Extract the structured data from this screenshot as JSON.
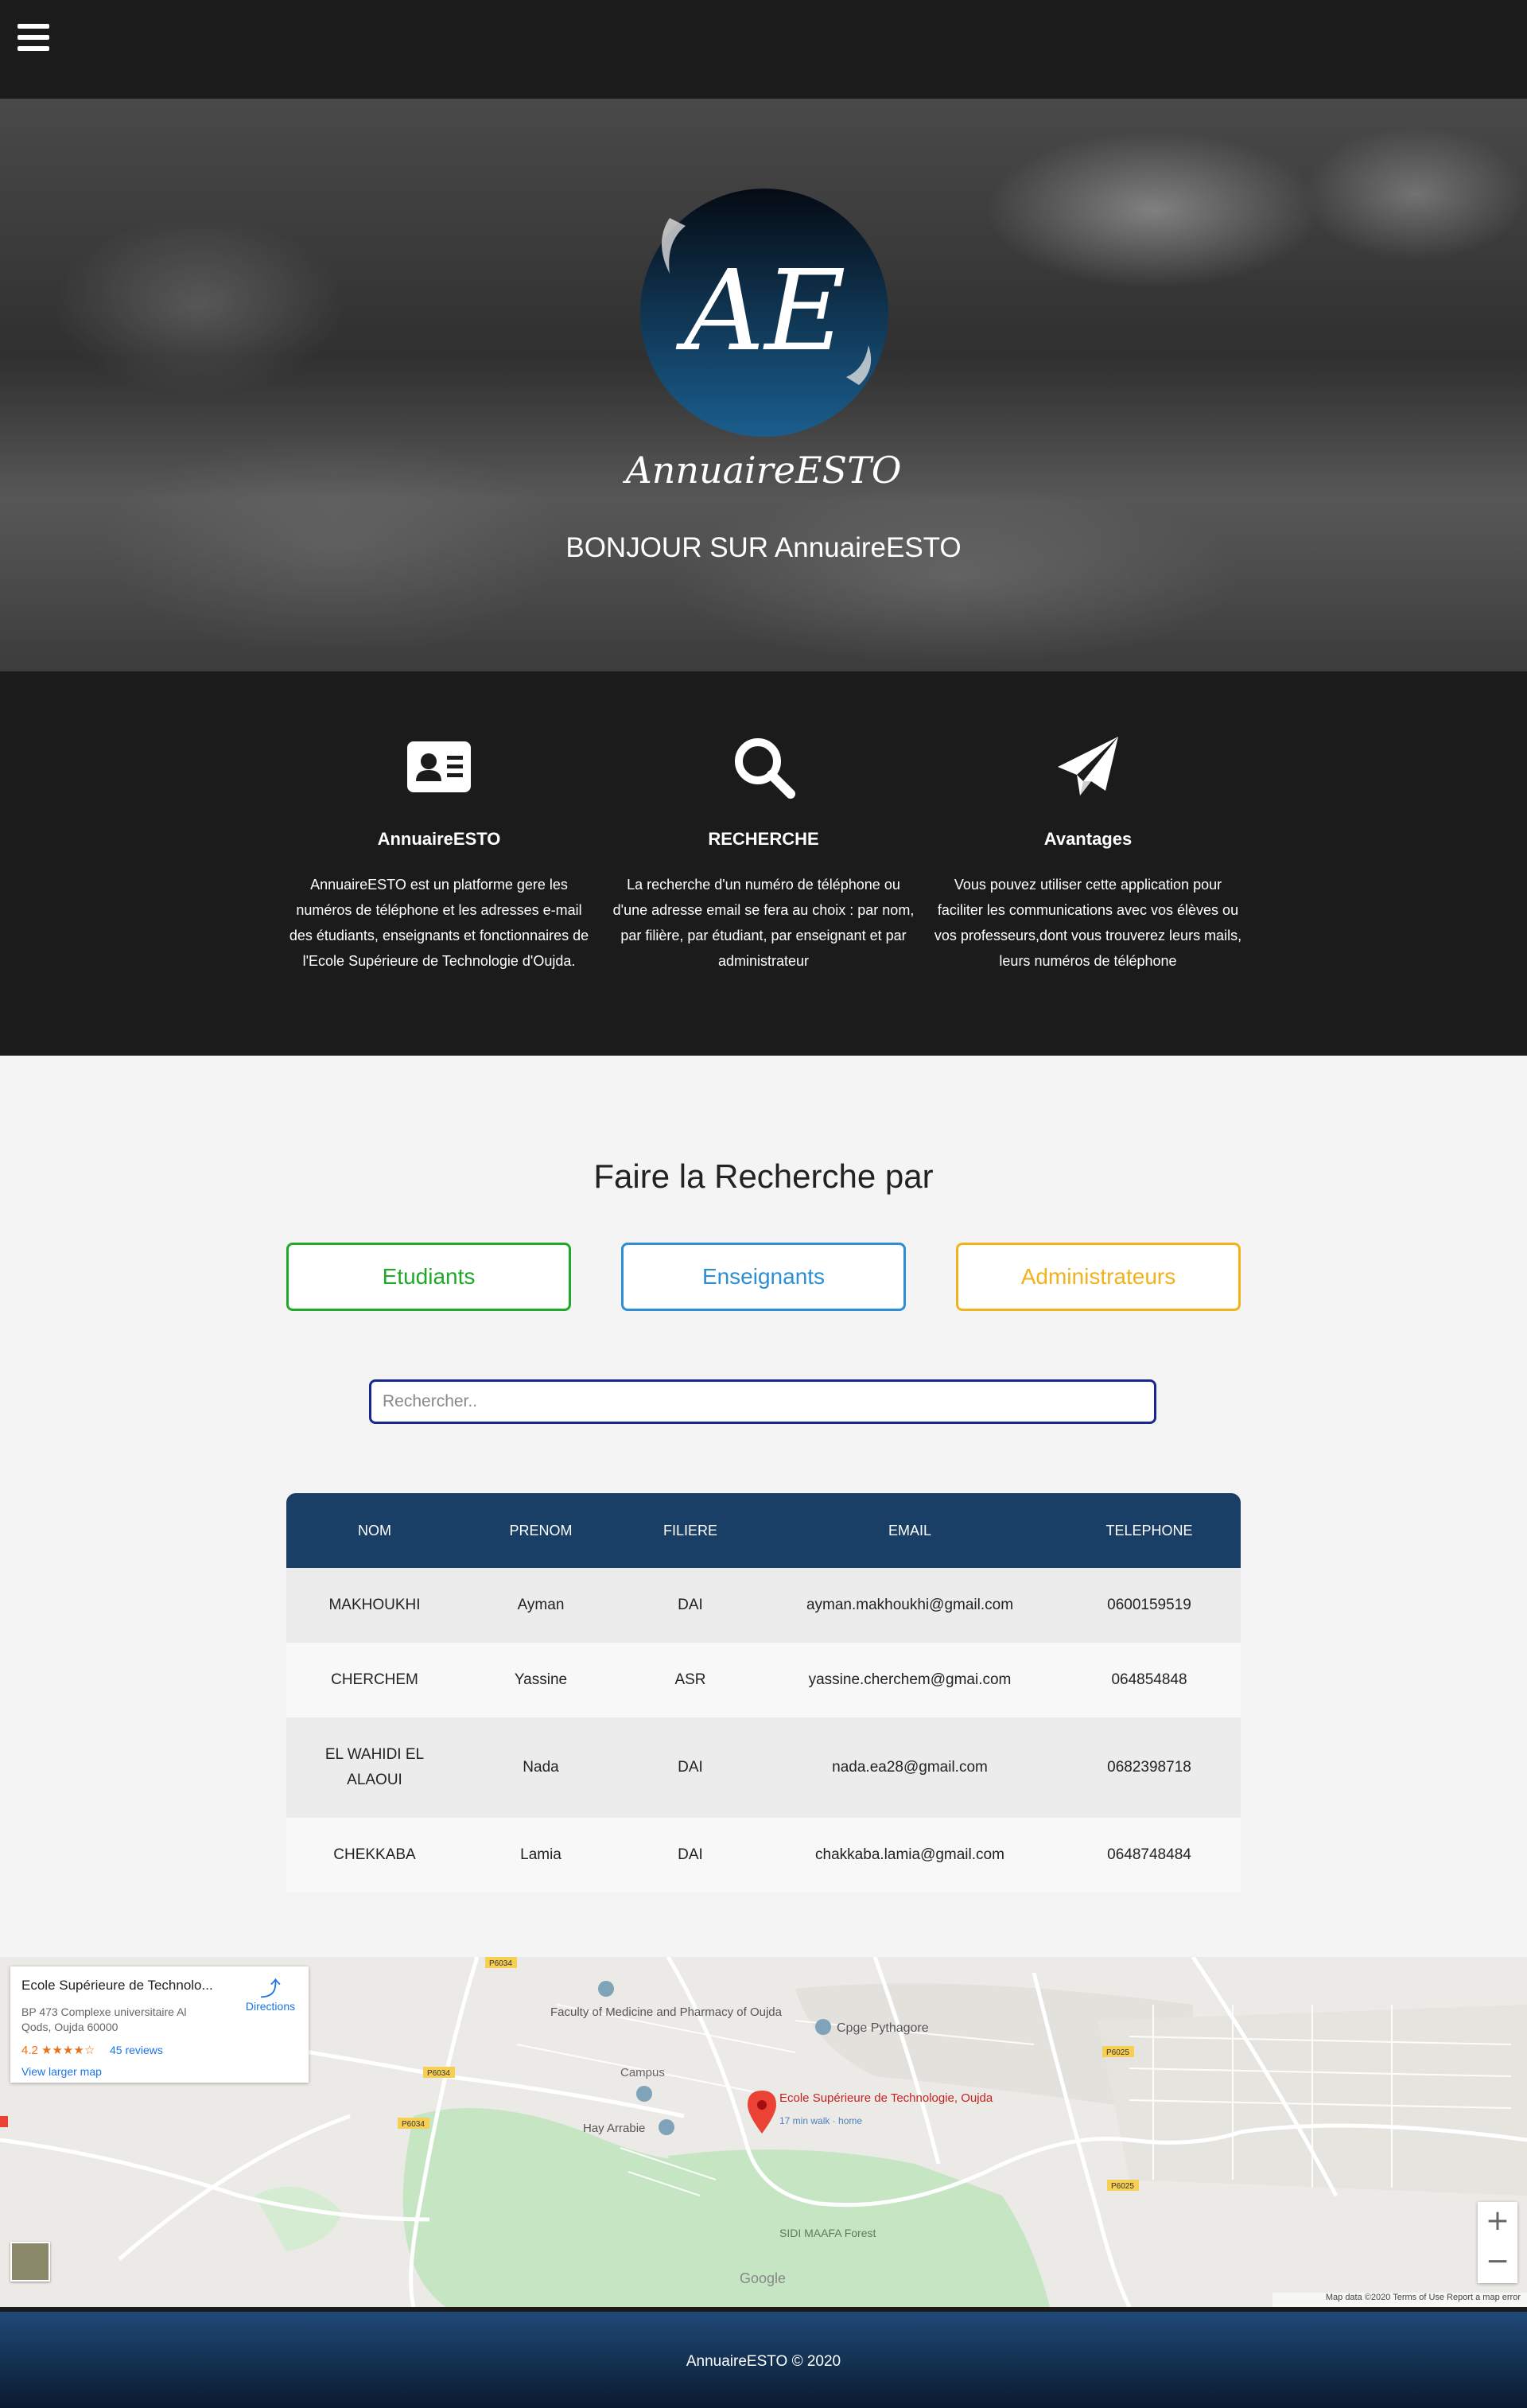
{
  "nav": {
    "menu_icon": "hamburger-menu-icon"
  },
  "hero": {
    "logo_text": "AE",
    "brand": "AnnuaireESTO",
    "welcome": "BONJOUR SUR AnnuaireESTO"
  },
  "features": [
    {
      "icon": "id-card-icon",
      "title": "AnnuaireESTO",
      "text": "AnnuaireESTO est un platforme gere les numéros de téléphone et les adresses e-mail des étudiants, enseignants et fonctionnaires de l'Ecole Supérieure de Technologie d'Oujda."
    },
    {
      "icon": "search-icon",
      "title": "RECHERCHE",
      "text": "La recherche d'un numéro de téléphone ou d'une adresse email se fera au choix : par nom, par filière, par étudiant, par enseignant et par administrateur"
    },
    {
      "icon": "paper-plane-icon",
      "title": "Avantages",
      "text": "Vous pouvez utiliser cette application pour faciliter les communications avec vos élèves ou vos professeurs,dont vous trouverez leurs mails, leurs numéros de téléphone"
    }
  ],
  "search": {
    "title": "Faire la Recherche par",
    "buttons": [
      {
        "label": "Etudiants",
        "color": "#1fa82a"
      },
      {
        "label": "Enseignants",
        "color": "#2b8fd6"
      },
      {
        "label": "Administrateurs",
        "color": "#f2b21b"
      }
    ],
    "placeholder": "Rechercher.."
  },
  "table": {
    "headers": [
      "NOM",
      "PRENOM",
      "FILIERE",
      "EMAIL",
      "TELEPHONE"
    ],
    "rows": [
      [
        "MAKHOUKHI",
        "Ayman",
        "DAI",
        "ayman.makhoukhi@gmail.com",
        "0600159519"
      ],
      [
        "CHERCHEM",
        "Yassine",
        "ASR",
        "yassine.cherchem@gmai.com",
        "064854848"
      ],
      [
        "EL WAHIDI EL ALAOUI",
        "Nada",
        "DAI",
        "nada.ea28@gmail.com",
        "0682398718"
      ],
      [
        "CHEKKABA",
        "Lamia",
        "DAI",
        "chakkaba.lamia@gmail.com",
        "0648748484"
      ]
    ]
  },
  "map": {
    "card_name": "Ecole Supérieure de Technolo...",
    "card_address": "BP 473 Complexe universitaire Al Qods, Oujda 60000",
    "rating": "4.2",
    "reviews": "45 reviews",
    "larger_map": "View larger map",
    "directions": "Directions",
    "labels": {
      "faculty": "Faculty of Medicine and Pharmacy of Oujda",
      "cpge": "Cpge Pythagore",
      "campus": "Campus",
      "hay": "Hay Arrabie",
      "school": "Ecole Supérieure de Technologie, Oujda",
      "walk": "17 min walk · home",
      "sidi": "SIDI MAAFA Forest",
      "p6034a": "P6034",
      "p6034b": "P6034",
      "p6025a": "P6025",
      "p6025b": "P6025",
      "p6034c": "P6034"
    },
    "google": "Google",
    "footer": "Map data ©2020    Terms of Use    Report a map error"
  },
  "footer": {
    "text": "AnnuaireESTO © 2020"
  }
}
